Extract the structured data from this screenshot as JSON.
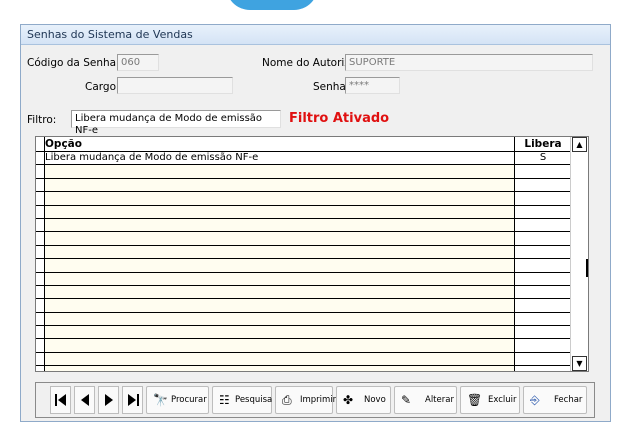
{
  "window": {
    "title": "Senhas do Sistema de Vendas"
  },
  "form": {
    "codigo_label": "Código da Senha:",
    "codigo_value": "060",
    "autorizado_label": "Nome do Autorizado:",
    "autorizado_value": "SUPORTE",
    "cargo_label": "Cargo:",
    "cargo_value": "",
    "senha_label": "Senha:",
    "senha_value": "****",
    "filtro_label": "Filtro:",
    "filtro_value": "Libera mudança de Modo de emissão NF-e",
    "filtro_status": "Filtro Ativado"
  },
  "grid": {
    "columns": [
      "Opção",
      "Libera"
    ],
    "rows": [
      [
        "Libera mudança de Modo de emissão NF-e",
        "S"
      ],
      [
        "",
        ""
      ],
      [
        "",
        ""
      ],
      [
        "",
        ""
      ],
      [
        "",
        ""
      ],
      [
        "",
        ""
      ],
      [
        "",
        ""
      ],
      [
        "",
        ""
      ],
      [
        "",
        ""
      ],
      [
        "",
        ""
      ],
      [
        "",
        ""
      ],
      [
        "",
        ""
      ],
      [
        "",
        ""
      ],
      [
        "",
        ""
      ],
      [
        "",
        ""
      ],
      [
        "",
        ""
      ],
      [
        "",
        ""
      ]
    ]
  },
  "toolbar": {
    "procurar": "Procurar",
    "pesquisa": "Pesquisa",
    "imprimir": "Imprimir",
    "novo": "Novo",
    "alterar": "Alterar",
    "excluir": "Excluir",
    "fechar": "Fechar"
  },
  "colors": {
    "accent": "#3fa3e0",
    "filter_status": "#e01010",
    "row_bg": "#fffdf0"
  }
}
